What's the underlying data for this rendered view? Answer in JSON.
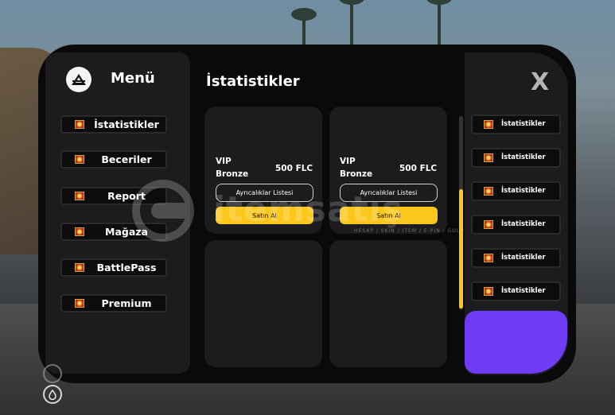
{
  "menu": {
    "title": "Menü"
  },
  "sidebar": {
    "items": [
      {
        "label": "İstatistikler"
      },
      {
        "label": "Beceriler"
      },
      {
        "label": "Report"
      },
      {
        "label": "Mağaza"
      },
      {
        "label": "BattlePass"
      },
      {
        "label": "Premium"
      }
    ]
  },
  "content": {
    "title": "İstatistikler",
    "cards": [
      {
        "tier_line1": "VIP",
        "tier_line2": "Bronze",
        "price": "500 FLC",
        "privileges_label": "Ayrıcalıklar Listesi",
        "buy_label": "Satın Al"
      },
      {
        "tier_line1": "VIP",
        "tier_line2": "Bronze",
        "price": "500 FLC",
        "privileges_label": "Ayrıcalıklar Listesi",
        "buy_label": "Satın Al"
      }
    ]
  },
  "right_panel": {
    "close_label": "X",
    "items": [
      {
        "label": "İstatistikler"
      },
      {
        "label": "İstatistikler"
      },
      {
        "label": "İstatistikler"
      },
      {
        "label": "İstatistikler"
      },
      {
        "label": "İstatistikler"
      },
      {
        "label": "İstatistikler"
      }
    ]
  },
  "watermark": {
    "text": "itemsatış",
    "subtext": "HESAP / SKIN / ITEM / E-PIN / GOLD"
  },
  "colors": {
    "accent": "#fcc71d",
    "purple": "#6f3bf5",
    "panel": "#0a0a0b",
    "card": "#1c1c1f"
  },
  "icons": {
    "item_icon": "sun-badge-icon",
    "logo": "mountain-logo-icon"
  }
}
